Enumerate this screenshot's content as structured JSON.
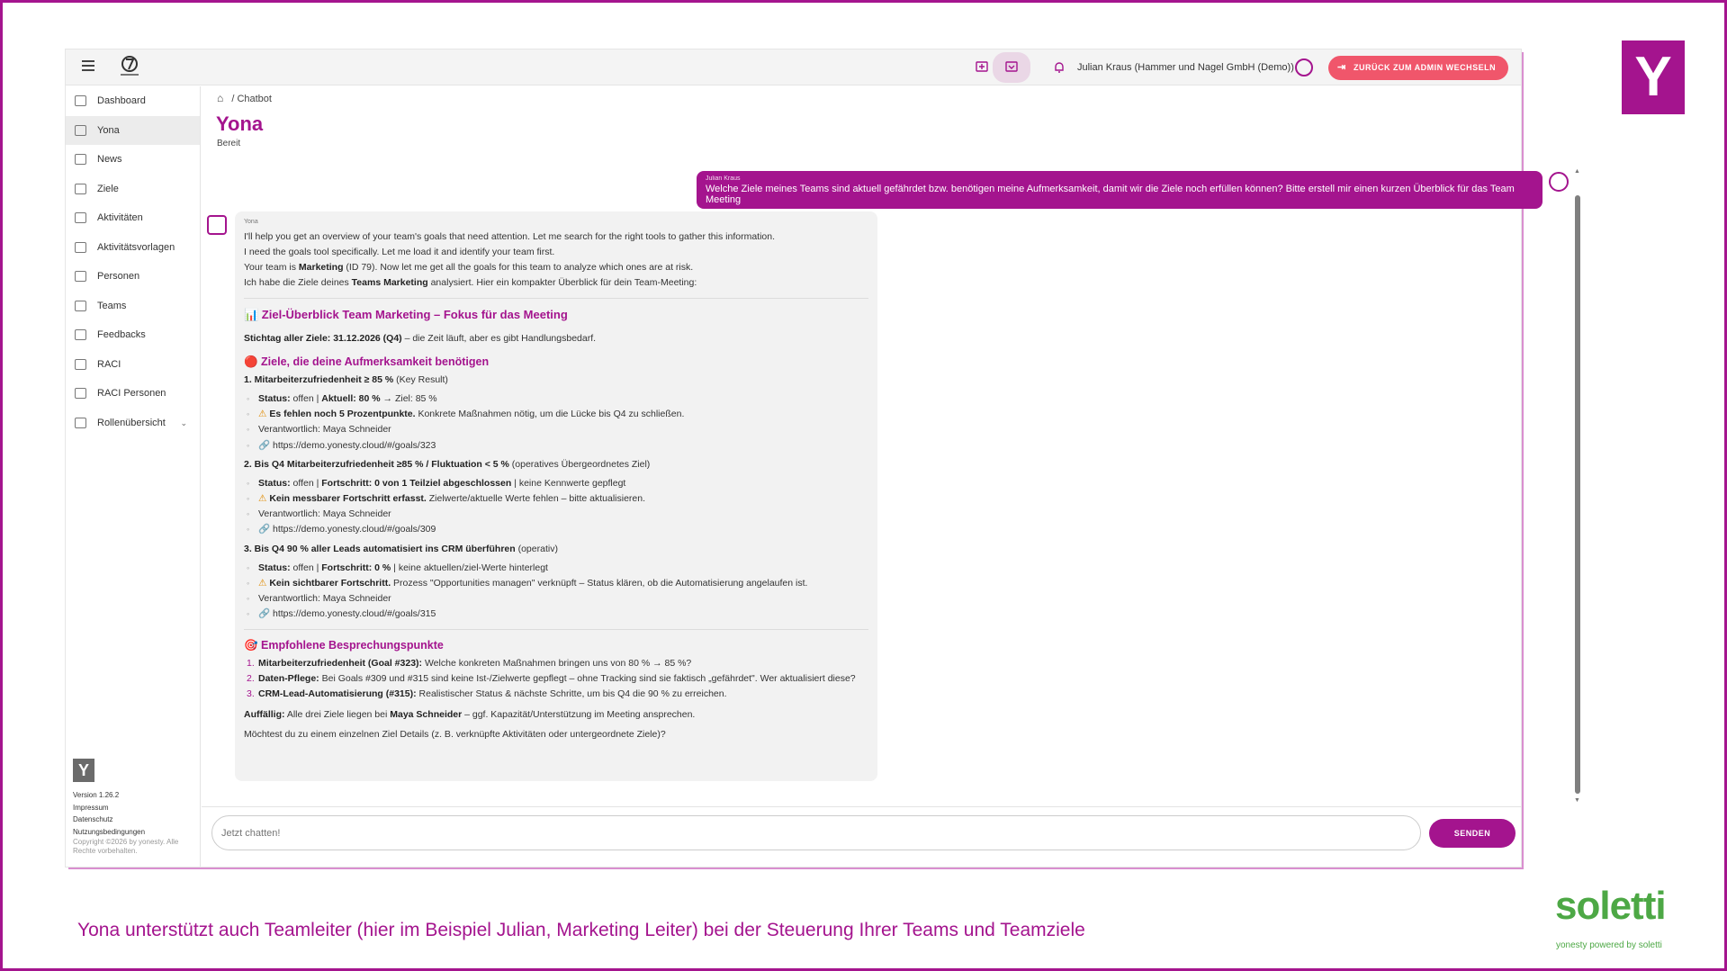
{
  "topbar": {
    "user_name": "Julian Kraus (Hammer und Nagel GmbH (Demo))",
    "admin_button": "ZURÜCK ZUM ADMIN WECHSELN"
  },
  "sidebar": {
    "items": [
      {
        "label": "Dashboard"
      },
      {
        "label": "Yona"
      },
      {
        "label": "News"
      },
      {
        "label": "Ziele"
      },
      {
        "label": "Aktivitäten"
      },
      {
        "label": "Aktivitätsvorlagen"
      },
      {
        "label": "Personen"
      },
      {
        "label": "Teams"
      },
      {
        "label": "Feedbacks"
      },
      {
        "label": "RACI"
      },
      {
        "label": "RACI Personen"
      },
      {
        "label": "Rollenübersicht"
      }
    ],
    "version": "Version 1.26.2",
    "impressum": "Impressum",
    "datenschutz": "Datenschutz",
    "nutzung": "Nutzungsbedingungen",
    "copyright": "Copyright ©2026 by yonesty. Alle Rechte vorbehalten."
  },
  "breadcrumb": {
    "current": "Chatbot"
  },
  "page": {
    "title": "Yona",
    "status": "Bereit"
  },
  "user_message": {
    "author": "Julian Kraus",
    "text": "Welche Ziele meines Teams sind aktuell gefährdet bzw. benötigen meine Aufmerksamkeit, damit wir die Ziele noch erfüllen können? Bitte erstell mir einen kurzen Überblick für das Team Meeting"
  },
  "bot_message": {
    "author": "Yona",
    "intro1": "I'll help you get an overview of your team's goals that need attention. Let me search for the right tools to gather this information.",
    "intro2": "I need the goals tool specifically. Let me load it and identify your team first.",
    "intro3_a": "Your team is ",
    "intro3_b": "Marketing",
    "intro3_c": " (ID 79). Now let me get all the goals for this team to analyze which ones are at risk.",
    "intro4_a": "Ich habe die Ziele deines ",
    "intro4_b": "Teams Marketing",
    "intro4_c": " analysiert. Hier ein kompakter Überblick für dein Team-Meeting:",
    "overview_title": "📊 Ziel-Überblick Team Marketing – Fokus für das Meeting",
    "deadline_b": "Stichtag aller Ziele: 31.12.2026 (Q4)",
    "deadline_rest": " – die Zeit läuft, aber es gibt Handlungsbedarf.",
    "attention_title": "🔴 Ziele, die deine Aufmerksamkeit benötigen",
    "goals": [
      {
        "title_b": "1. Mitarbeiterzufriedenheit ≥ 85 %",
        "title_rest": " (Key Result)",
        "status_b1": "Status:",
        "status_1": " offen | ",
        "status_b2": "Aktuell: 80 %",
        "status_2": " → Ziel: 85 %",
        "warn_b": "Es fehlen noch 5 Prozentpunkte.",
        "warn_rest": " Konkrete Maßnahmen nötig, um die Lücke bis Q4 zu schließen.",
        "owner": "Verantwortlich: Maya Schneider",
        "link": "https://demo.yonesty.cloud/#/goals/323"
      },
      {
        "title_b": "2. Bis Q4 Mitarbeiterzufriedenheit ≥85 % / Fluktuation < 5 %",
        "title_rest": " (operatives Übergeordnetes Ziel)",
        "status_b1": "Status:",
        "status_1": " offen | ",
        "status_b2": "Fortschritt: 0 von 1 Teilziel abgeschlossen",
        "status_2": " | keine Kennwerte gepflegt",
        "warn_b": "Kein messbarer Fortschritt erfasst.",
        "warn_rest": " Zielwerte/aktuelle Werte fehlen – bitte aktualisieren.",
        "owner": "Verantwortlich: Maya Schneider",
        "link": "https://demo.yonesty.cloud/#/goals/309"
      },
      {
        "title_b": "3. Bis Q4 90 % aller Leads automatisiert ins CRM überführen",
        "title_rest": " (operativ)",
        "status_b1": "Status:",
        "status_1": " offen | ",
        "status_b2": "Fortschritt: 0 %",
        "status_2": " | keine aktuellen/ziel-Werte hinterlegt",
        "warn_b": "Kein sichtbarer Fortschritt.",
        "warn_rest": " Prozess \"Opportunities managen\" verknüpft – Status klären, ob die Automatisierung angelaufen ist.",
        "owner": "Verantwortlich: Maya Schneider",
        "link": "https://demo.yonesty.cloud/#/goals/315"
      }
    ],
    "points_title": "🎯 Empfohlene Besprechungspunkte",
    "points": [
      {
        "n": "1.",
        "b": "Mitarbeiterzufriedenheit (Goal #323):",
        "rest": " Welche konkreten Maßnahmen bringen uns von 80 % → 85 %?"
      },
      {
        "n": "2.",
        "b": "Daten-Pflege:",
        "rest": " Bei Goals #309 und #315 sind keine Ist-/Zielwerte gepflegt – ohne Tracking sind sie faktisch „gefährdet\". Wer aktualisiert diese?"
      },
      {
        "n": "3.",
        "b": "CRM-Lead-Automatisierung (#315):",
        "rest": " Realistischer Status & nächste Schritte, um bis Q4 die 90 % zu erreichen."
      }
    ],
    "notable_b": "Auffällig:",
    "notable_1": " Alle drei Ziele liegen bei ",
    "notable_b2": "Maya Schneider",
    "notable_2": " – ggf. Kapazität/Unterstützung im Meeting ansprechen.",
    "closing": "Möchtest du zu einem einzelnen Ziel Details (z. B. verknüpfte Aktivitäten oder untergeordnete Ziele)?"
  },
  "chat_input": {
    "placeholder": "Jetzt chatten!"
  },
  "send_button": "SENDEN",
  "caption": "Yona unterstützt auch Teamleiter (hier im Beispiel Julian, Marketing Leiter) bei der Steuerung Ihrer Teams und Teamziele",
  "brand": {
    "name": "soletti",
    "tagline": "yonesty powered by soletti",
    "y_letter": "Y"
  },
  "colors": {
    "accent": "#a4148e",
    "admin_button": "#f0566b",
    "soletti_green": "#4da845"
  }
}
